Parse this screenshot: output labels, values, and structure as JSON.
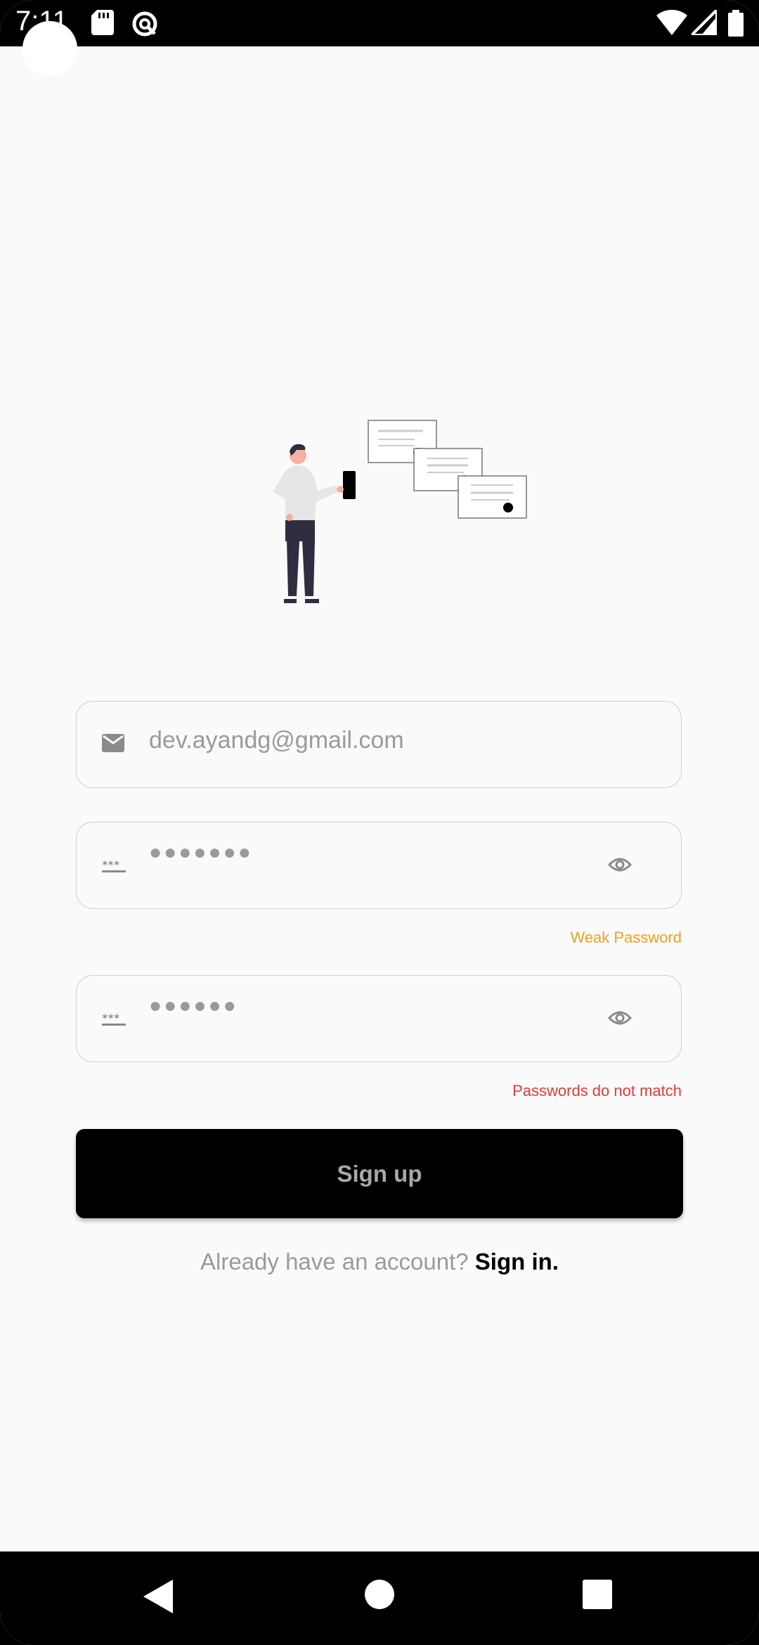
{
  "status_bar": {
    "time": "7:11",
    "icons": [
      "sd-card-icon",
      "data-saver-icon",
      "wifi-icon",
      "signal-icon",
      "battery-icon"
    ]
  },
  "illustration": {
    "name": "person-with-phone-and-cards-illustration"
  },
  "email_field": {
    "icon": "mail-icon",
    "value": "dev.ayandg@gmail.com"
  },
  "password_field": {
    "icon": "password-icon",
    "masked_value": "●●●●●●●",
    "toggle_icon": "eye-icon",
    "helper": "Weak Password"
  },
  "confirm_password_field": {
    "icon": "password-icon",
    "masked_value": "●●●●●●",
    "toggle_icon": "eye-icon",
    "helper": "Passwords do not match"
  },
  "signup_button": {
    "label": "Sign up"
  },
  "signin": {
    "prompt": "Already have an account?",
    "link": "Sign in."
  },
  "colors": {
    "background": "#fafafa",
    "primary": "#000000",
    "warning": "#f0a020",
    "error": "#e53935",
    "muted": "#9a9a9a"
  }
}
